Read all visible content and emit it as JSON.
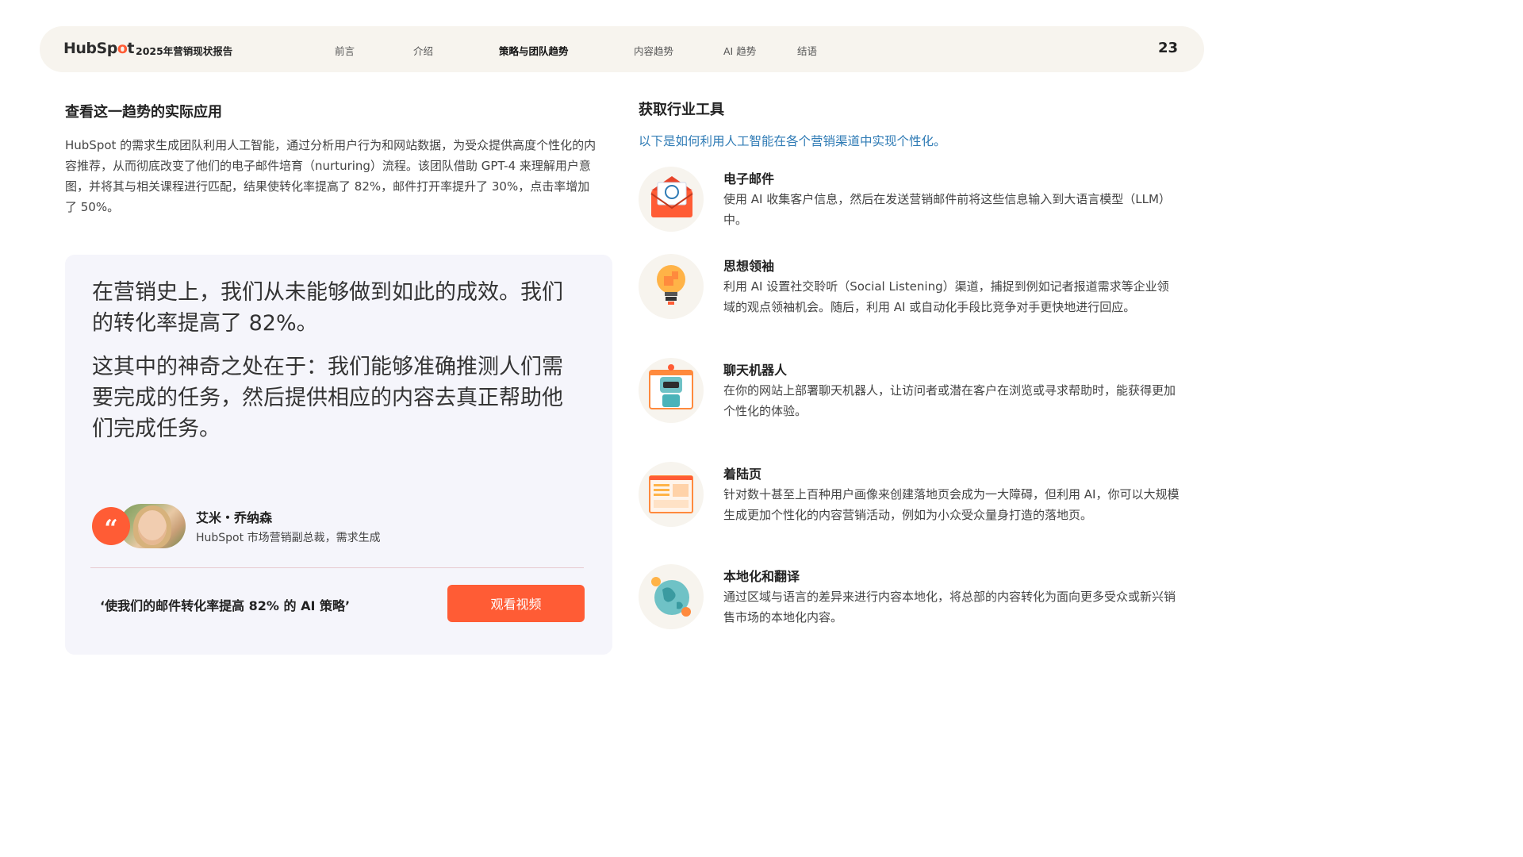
{
  "header": {
    "logo_text": "HubSpot",
    "report_title": "2025年营销现状报告",
    "nav": [
      "前言",
      "介绍",
      "策略与团队趋势",
      "内容趋势",
      "AI 趋势",
      "结语"
    ],
    "active_index": 2,
    "page_number": "23"
  },
  "left": {
    "heading": "查看这一趋势的实际应用",
    "intro": "HubSpot 的需求生成团队利用人工智能，通过分析用户行为和网站数据，为受众提供高度个性化的内容推荐，从而彻底改变了他们的电子邮件培育（nurturing）流程。该团队借助 GPT-4 来理解用户意图，并将其与相关课程进行匹配，结果使转化率提高了 82%，邮件打开率提升了 30%，点击率增加了 50%。",
    "quote_1": "在营销史上，我们从未能够做到如此的成效。我们的转化率提高了 82%。",
    "quote_2": "这其中的神奇之处在于：我们能够准确推测人们需要完成的任务，然后提供相应的内容去真正帮助他们完成任务。",
    "quote_mark": "“",
    "person_name": "艾米・乔纳森",
    "person_title": "HubSpot 市场营销副总裁，需求生成",
    "video_caption": "‘使我们的邮件转化率提高 82% 的 AI 策略’",
    "video_button": "观看视频"
  },
  "right": {
    "heading": "获取行业工具",
    "subheading": "以下是如何利用人工智能在各个营销渠道中实现个性化。",
    "tools": [
      {
        "icon": "email-icon",
        "title": "电子邮件",
        "desc": "使用 AI 收集客户信息，然后在发送营销邮件前将这些信息输入到大语言模型（LLM）中。"
      },
      {
        "icon": "lightbulb-icon",
        "title": "思想领袖",
        "desc": "利用 AI 设置社交聆听（Social Listening）渠道，捕捉到例如记者报道需求等企业领域的观点领袖机会。随后，利用 AI 或自动化手段比竞争对手更快地进行回应。"
      },
      {
        "icon": "chatbot-icon",
        "title": "聊天机器人",
        "desc": "在你的网站上部署聊天机器人，让访问者或潜在客户在浏览或寻求帮助时，能获得更加个性化的体验。"
      },
      {
        "icon": "landing-page-icon",
        "title": "着陆页",
        "desc": "针对数十甚至上百种用户画像来创建落地页会成为一大障碍，但利用 AI，你可以大规模生成更加个性化的内容营销活动，例如为小众受众量身打造的落地页。"
      },
      {
        "icon": "globe-icon",
        "title": "本地化和翻译",
        "desc": "通过区域与语言的差异来进行内容本地化，将总部的内容转化为面向更多受众或新兴销售市场的本地化内容。"
      }
    ]
  },
  "colors": {
    "accent": "#ff5c35",
    "link": "#2f7bb5",
    "bar": "#f7f4ee",
    "card": "#f5f5fb"
  }
}
